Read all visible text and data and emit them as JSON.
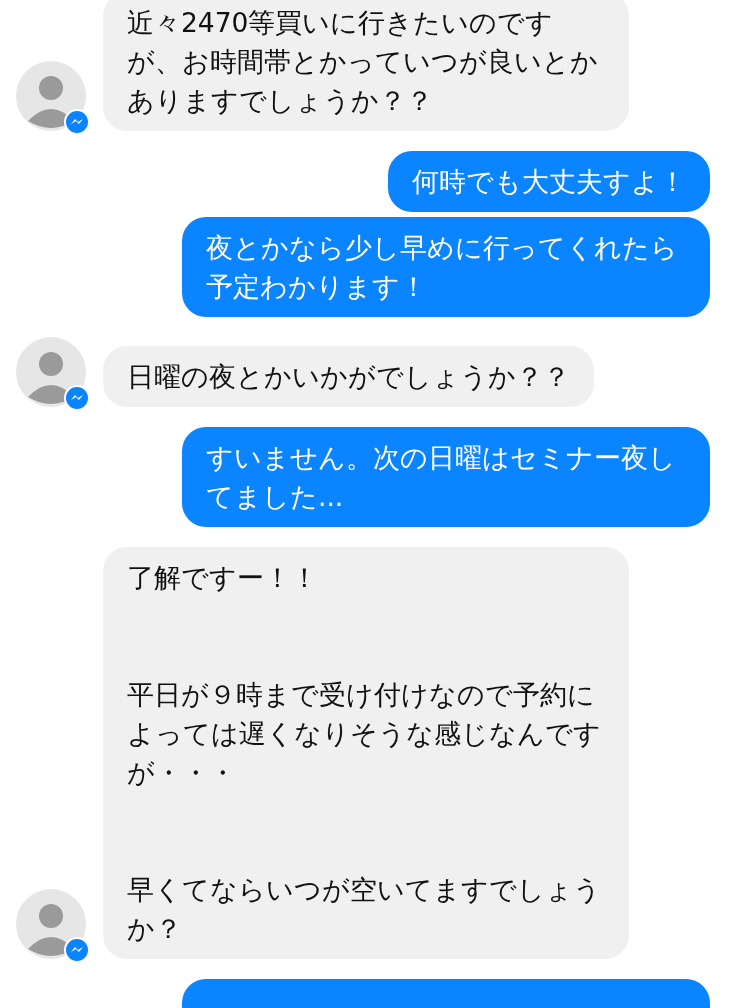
{
  "messages": [
    {
      "kind": "incoming",
      "text": "近々2470等買いに行きたいのですが、お時間帯とかっていつが良いとかありますでしょうか？？"
    },
    {
      "kind": "outgoing",
      "text": "何時でも大丈夫すよ！"
    },
    {
      "kind": "outgoing",
      "text": "夜とかなら少し早めに行ってくれたら予定わかります！"
    },
    {
      "kind": "incoming",
      "text": "日曜の夜とかいかがでしょうか？？"
    },
    {
      "kind": "outgoing",
      "text": "すいません。次の日曜はセミナー夜してました..."
    },
    {
      "kind": "incoming",
      "paragraphs": [
        "了解ですー！！",
        "平日が９時まで受け付けなので予約によっては遅くなりそうな感じなんですが・・・",
        "早くてならいつが空いてますでしょうか？"
      ]
    },
    {
      "kind": "outgoing"
    }
  ]
}
